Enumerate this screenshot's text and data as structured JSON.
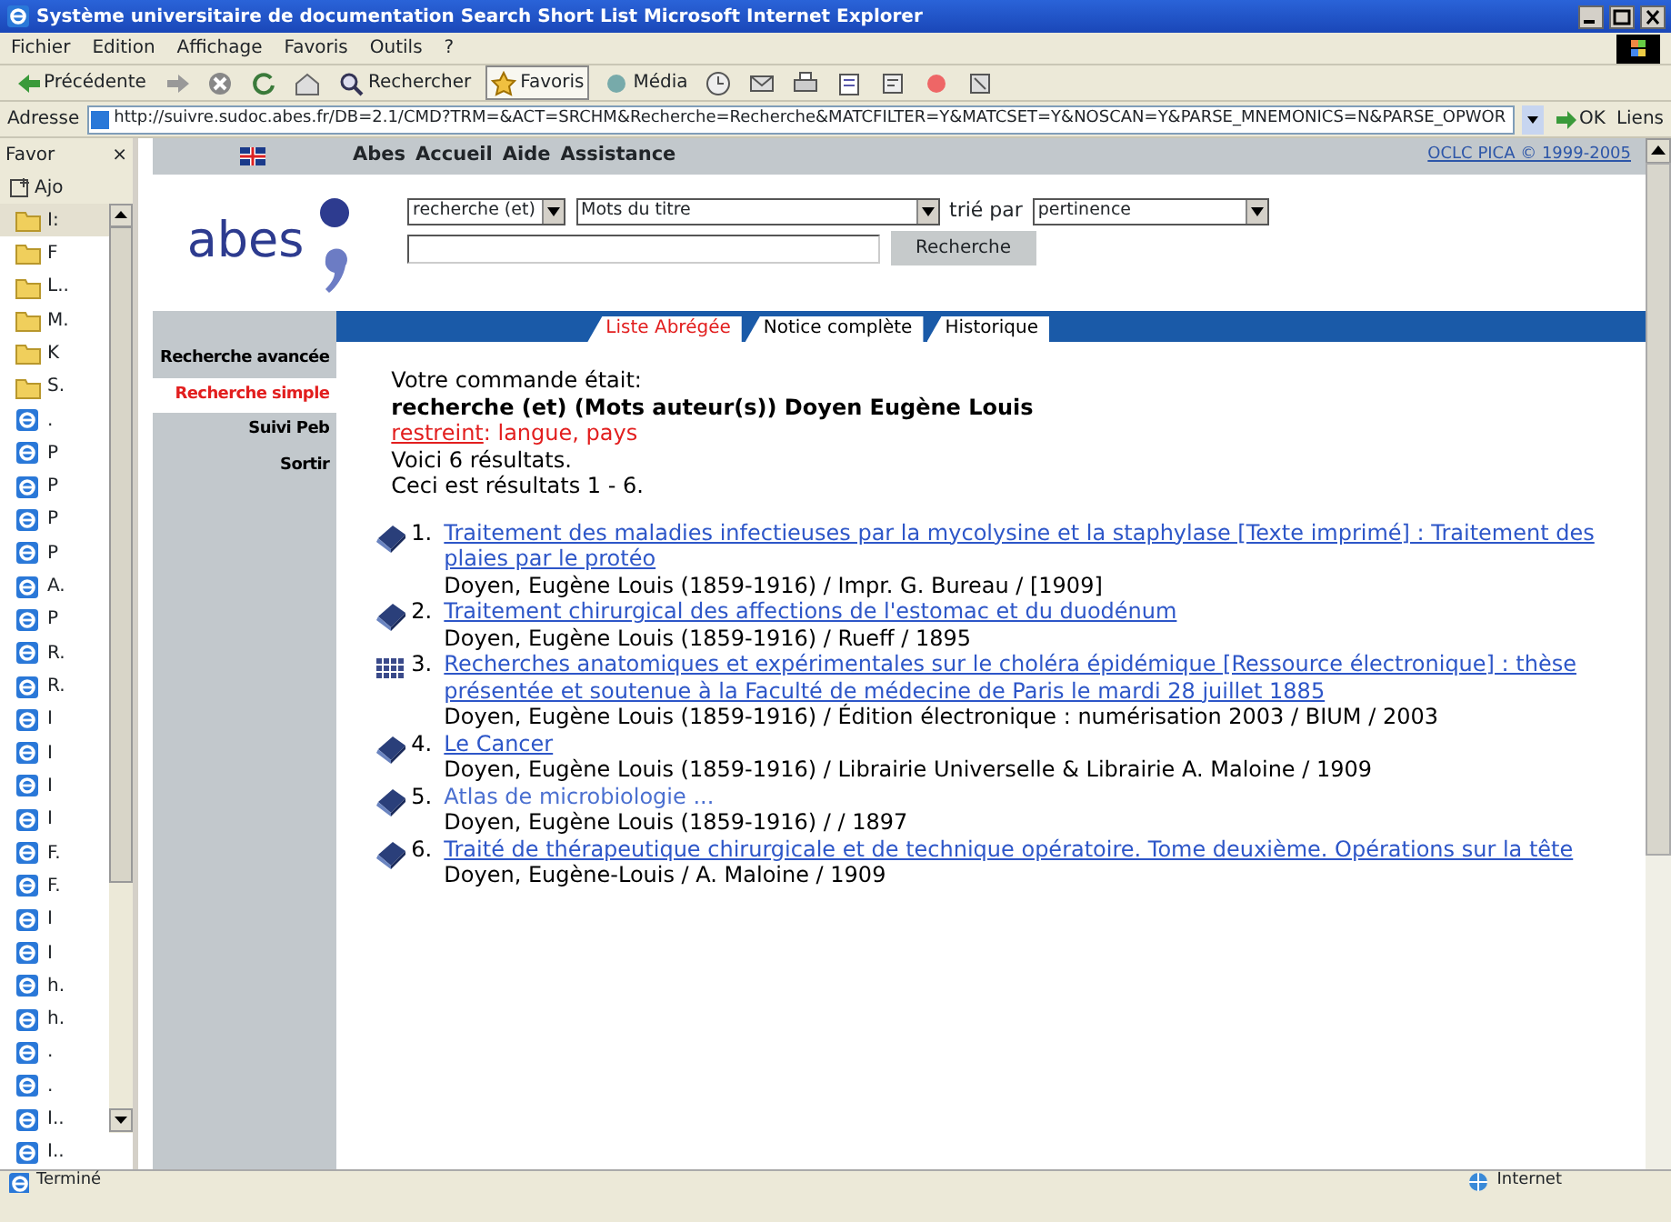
{
  "window": {
    "title": "Système universitaire de documentation  Search Short List  Microsoft Internet Explorer"
  },
  "menu": [
    "Fichier",
    "Edition",
    "Affichage",
    "Favoris",
    "Outils",
    "?"
  ],
  "toolbar": [
    {
      "label": "Précédente",
      "kind": "back",
      "selected": false
    },
    {
      "kind": "forward"
    },
    {
      "kind": "stop"
    },
    {
      "kind": "refresh"
    },
    {
      "kind": "home"
    },
    {
      "label": "Rechercher",
      "kind": "search",
      "selected": false
    },
    {
      "label": "Favoris",
      "kind": "favorites",
      "selected": true
    },
    {
      "label": "Média",
      "kind": "media",
      "selected": false
    },
    {
      "kind": "history"
    },
    {
      "kind": "mail"
    },
    {
      "kind": "print"
    },
    {
      "kind": "edit"
    },
    {
      "kind": "discuss"
    },
    {
      "kind": "messenger"
    },
    {
      "kind": "research"
    }
  ],
  "address": {
    "label": "Adresse",
    "value": "http://suivre.sudoc.abes.fr/DB=2.1/CMD?TRM=&ACT=SRCHM&Recherche=Recherche&MATCFILTER=Y&MATCSET=Y&NOSCAN=Y&PARSE_MNEMONICS=N&PARSE_OPWOR",
    "go": "OK",
    "links": "Liens"
  },
  "favorites": {
    "title": "Favor",
    "close": "×",
    "add": "Ajo",
    "items": [
      {
        "kind": "folder",
        "label": "I:",
        "selected": true
      },
      {
        "kind": "folder",
        "label": "F",
        "selected": false
      },
      {
        "kind": "folder",
        "label": "L..",
        "selected": false
      },
      {
        "kind": "folder",
        "label": "M.",
        "selected": false
      },
      {
        "kind": "folder",
        "label": "K",
        "selected": false
      },
      {
        "kind": "folder",
        "label": "S.",
        "selected": false
      },
      {
        "kind": "page",
        "label": ".",
        "selected": false
      },
      {
        "kind": "page",
        "label": "P",
        "selected": false
      },
      {
        "kind": "page",
        "label": "P",
        "selected": false
      },
      {
        "kind": "page",
        "label": "P",
        "selected": false
      },
      {
        "kind": "page",
        "label": "P",
        "selected": false
      },
      {
        "kind": "page",
        "label": "A.",
        "selected": false
      },
      {
        "kind": "page",
        "label": "P",
        "selected": false
      },
      {
        "kind": "page",
        "label": "R.",
        "selected": false
      },
      {
        "kind": "page",
        "label": "R.",
        "selected": false
      },
      {
        "kind": "page",
        "label": "I",
        "selected": false
      },
      {
        "kind": "page",
        "label": "I",
        "selected": false
      },
      {
        "kind": "page",
        "label": "I",
        "selected": false
      },
      {
        "kind": "page",
        "label": "I",
        "selected": false
      },
      {
        "kind": "page",
        "label": "F.",
        "selected": false
      },
      {
        "kind": "page",
        "label": "F.",
        "selected": false
      },
      {
        "kind": "page",
        "label": "I",
        "selected": false
      },
      {
        "kind": "page",
        "label": "I",
        "selected": false
      },
      {
        "kind": "page",
        "label": "h.",
        "selected": false
      },
      {
        "kind": "page",
        "label": "h.",
        "selected": false
      },
      {
        "kind": "page",
        "label": ".",
        "selected": false
      },
      {
        "kind": "page",
        "label": ".",
        "selected": false
      },
      {
        "kind": "page",
        "label": "I..",
        "selected": false
      },
      {
        "kind": "page",
        "label": "I..",
        "selected": false
      }
    ]
  },
  "topbar": {
    "links": [
      "Abes",
      "Accueil",
      "Aide",
      "Assistance"
    ],
    "copyright": "OCLC PICA © 1999-2005"
  },
  "logo": {
    "text": "abes"
  },
  "search": {
    "operator": "recherche (et)",
    "index": "Mots du titre",
    "sort_label": "trié par",
    "sort": "pertinence",
    "button": "Recherche"
  },
  "tabs": [
    {
      "label": "Liste Abrégée",
      "selected": true
    },
    {
      "label": "Notice complète",
      "selected": false
    },
    {
      "label": "Historique",
      "selected": false
    }
  ],
  "sidebar": {
    "items": [
      {
        "label": "Recherche avancée",
        "selected": false
      },
      {
        "label": "Recherche simple",
        "selected": true
      },
      {
        "label": "Suivi Peb",
        "selected": false
      },
      {
        "label": "Sortir",
        "selected": false
      }
    ]
  },
  "query": {
    "intro": "Votre commande était:",
    "command": "recherche (et) (Mots auteur(s)) Doyen Eugène Louis",
    "restriction_link": "restreint",
    "restriction": ": langue, pays",
    "count": "Voici 6 résultats.",
    "range": "Ceci est résultats 1 - 6."
  },
  "results": [
    {
      "kind": "book",
      "number": "1.",
      "title": "Traitement des maladies infectieuses par la mycolysine et la staphylase [Texte imprimé] : Traitement des plaies par le protéo",
      "details": "Doyen, Eugène Louis (1859-1916) / Impr. G. Bureau / [1909]",
      "visited": false
    },
    {
      "kind": "book",
      "number": "2.",
      "title": "Traitement chirurgical des affections de l'estomac et du duodénum",
      "details": "Doyen, Eugène Louis (1859-1916) / Rueff / 1895",
      "visited": false
    },
    {
      "kind": "electronic",
      "number": "3.",
      "title": "Recherches anatomiques et expérimentales sur le choléra épidémique [Ressource électronique] : thèse présentée et soutenue à la Faculté de médecine de Paris le mardi 28 juillet 1885",
      "details": "Doyen, Eugène Louis (1859-1916) / Édition électronique : numérisation 2003 / BIUM / 2003",
      "visited": false
    },
    {
      "kind": "book",
      "number": "4.",
      "title": "Le Cancer",
      "details": "Doyen, Eugène Louis (1859-1916) / Librairie Universelle & Librairie A. Maloine / 1909",
      "visited": false
    },
    {
      "kind": "book",
      "number": "5.",
      "title": "Atlas de microbiologie ...",
      "details": "Doyen, Eugène Louis (1859-1916) / / 1897",
      "visited": true
    },
    {
      "kind": "book",
      "number": "6.",
      "title": "Traité de thérapeutique chirurgicale et de technique opératoire. Tome deuxième. Opérations sur la tête",
      "details": "Doyen, Eugène-Louis / A. Maloine / 1909",
      "visited": false
    }
  ],
  "status_bar": {
    "text": "Terminé",
    "zone": "Internet"
  }
}
